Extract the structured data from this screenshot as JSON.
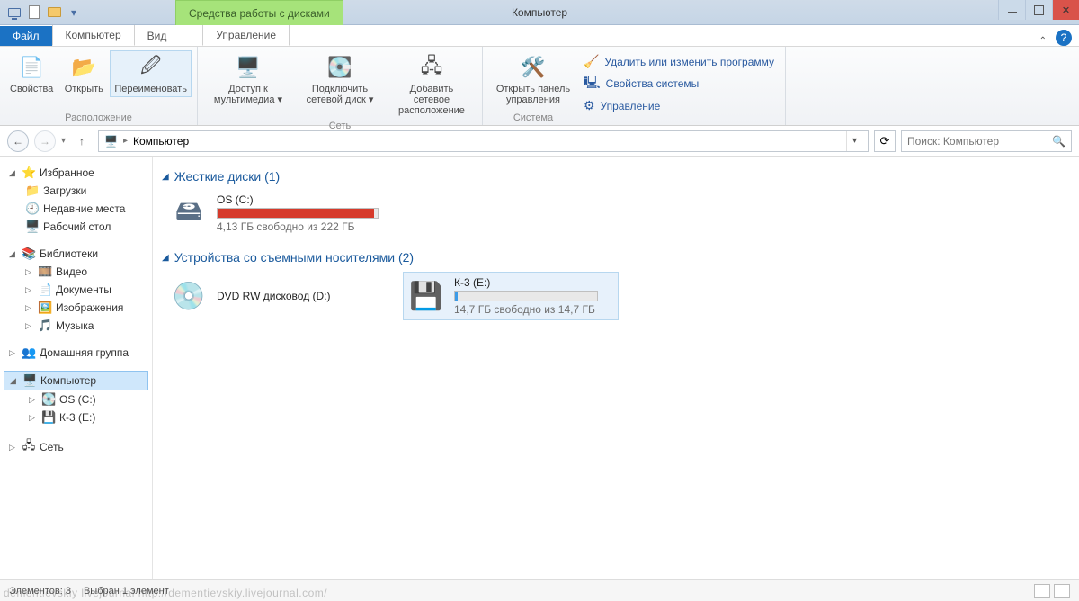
{
  "window": {
    "title": "Компьютер",
    "context_tab": "Средства работы с дисками"
  },
  "tabs": {
    "file": "Файл",
    "computer": "Компьютер",
    "view": "Вид",
    "manage": "Управление"
  },
  "ribbon": {
    "group_location": "Расположение",
    "group_network": "Сеть",
    "group_system": "Система",
    "btn_properties": "Свойства",
    "btn_open": "Открыть",
    "btn_rename": "Переименовать",
    "btn_media": "Доступ к\nмультимедиа ▾",
    "btn_mapdrive": "Подключить\nсетевой диск ▾",
    "btn_addnet": "Добавить сетевое\nрасположение",
    "btn_opencp": "Открыть панель\nуправления",
    "sys_uninstall": "Удалить или изменить программу",
    "sys_props": "Свойства системы",
    "sys_manage": "Управление"
  },
  "address": {
    "path": "Компьютер",
    "search_placeholder": "Поиск: Компьютер"
  },
  "nav": {
    "favorites": "Избранное",
    "downloads": "Загрузки",
    "recent": "Недавние места",
    "desktop": "Рабочий стол",
    "libraries": "Библиотеки",
    "video": "Видео",
    "documents": "Документы",
    "pictures": "Изображения",
    "music": "Музыка",
    "homegroup": "Домашняя группа",
    "computer": "Компьютер",
    "drive_c": "OS (C:)",
    "drive_e": "К-3 (E:)",
    "network": "Сеть"
  },
  "content": {
    "group_hdd": "Жесткие диски (1)",
    "group_removable": "Устройства со съемными носителями (2)",
    "drives": {
      "c": {
        "name": "OS (C:)",
        "summary": "4,13 ГБ свободно из 222 ГБ",
        "used_pct": 98,
        "bar_color": "#d63a2b"
      },
      "dvd": {
        "name": "DVD RW дисковод (D:)"
      },
      "e": {
        "name": "К-3 (E:)",
        "summary": "14,7 ГБ свободно из 14,7 ГБ",
        "used_pct": 2,
        "bar_color": "#3c9be8"
      }
    }
  },
  "status": {
    "count": "Элементов: 3",
    "selected": "Выбран 1 элемент"
  },
  "watermark": "dementievskiy livejournal http://dementievskiy.livejournal.com/"
}
